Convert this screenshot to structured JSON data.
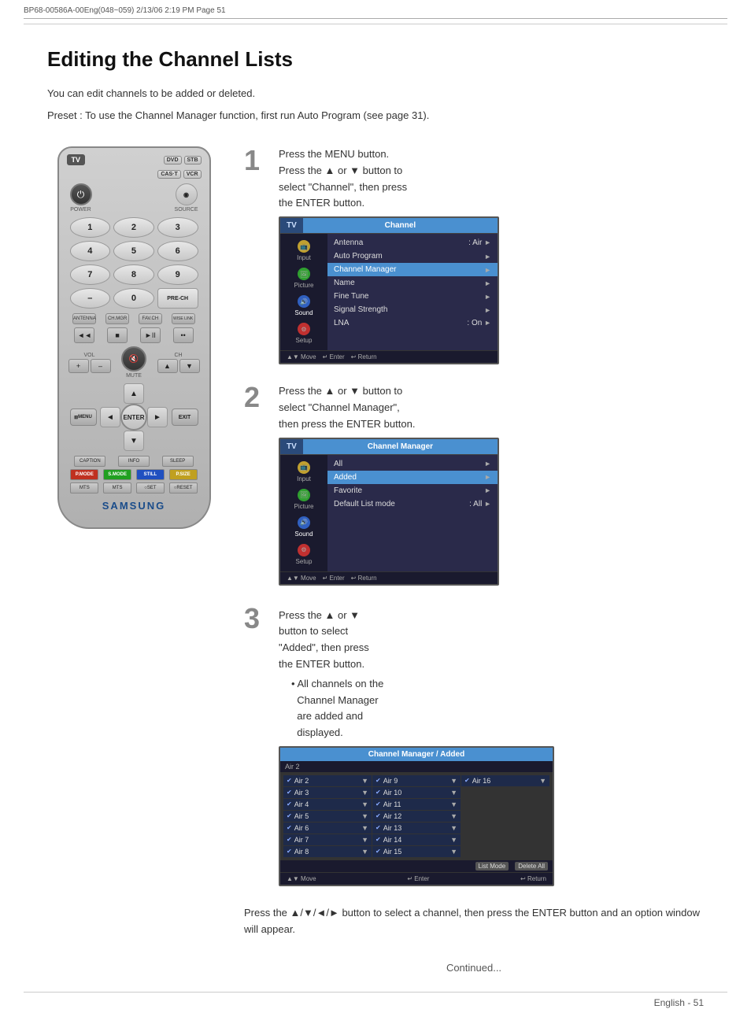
{
  "header": {
    "left_text": "BP68-00586A-00Eng(048~059)  2/13/06  2:19 PM  Page 51"
  },
  "page_title": "Editing the Channel Lists",
  "intro_lines": [
    "You can edit channels to be added or deleted.",
    "Preset : To use the Channel Manager function, first run Auto Program (see page 31)."
  ],
  "steps": [
    {
      "num": "1",
      "text_lines": [
        "Press the MENU button.",
        "Press the ▲ or ▼ button to",
        "select \"Channel\", then press",
        "the ENTER button."
      ]
    },
    {
      "num": "2",
      "text_lines": [
        "Press the ▲ or ▼ button to",
        "select \"Channel Manager\",",
        "then press the ENTER button."
      ]
    },
    {
      "num": "3",
      "text_lines": [
        "Press the ▲ or ▼",
        "button to select",
        "\"Added\", then press",
        "the ENTER button."
      ],
      "bullet": "All channels on the Channel Manager are added and displayed."
    }
  ],
  "press_arrow_text": "Press the ▲/▼/◄/► button to select a channel, then press the ENTER button and an option window will appear.",
  "continued_text": "Continued...",
  "footer": {
    "page_text": "English - 51"
  },
  "tv_menu_1": {
    "header_left": "TV",
    "header_right": "Channel",
    "sidebar_items": [
      {
        "icon": "input",
        "label": "Input"
      },
      {
        "icon": "picture",
        "label": "Picture"
      },
      {
        "icon": "sound",
        "label": "Sound"
      },
      {
        "icon": "setup",
        "label": "Setup"
      }
    ],
    "menu_items": [
      {
        "label": "Antenna",
        "value": ": Air",
        "selected": false
      },
      {
        "label": "Auto Program",
        "value": "",
        "selected": false
      },
      {
        "label": "Channel Manager",
        "value": "",
        "selected": true
      },
      {
        "label": "Name",
        "value": "",
        "selected": false
      },
      {
        "label": "Fine Tune",
        "value": "",
        "selected": false
      },
      {
        "label": "Signal Strength",
        "value": "",
        "selected": false
      },
      {
        "label": "LNA",
        "value": ": On",
        "selected": false
      }
    ],
    "footer": [
      "▲▼ Move",
      "↵ Enter",
      "↩ Return"
    ]
  },
  "tv_menu_2": {
    "header_left": "TV",
    "header_right": "Channel Manager",
    "menu_items": [
      {
        "label": "All",
        "value": "",
        "selected": false
      },
      {
        "label": "Added",
        "value": "",
        "selected": true
      },
      {
        "label": "Favorite",
        "value": "",
        "selected": false
      },
      {
        "label": "Default List mode",
        "value": ": All",
        "selected": false
      }
    ],
    "footer": [
      "▲▼ Move",
      "↵ Enter",
      "↩ Return"
    ]
  },
  "ch_manager": {
    "title": "Channel Manager / Added",
    "top_label": "Air 2",
    "channels_col1": [
      "Air 2",
      "Air 3",
      "Air 4",
      "Air 5",
      "Air 6",
      "Air 7",
      "Air 8"
    ],
    "channels_col2": [
      "Air 9",
      "Air 10",
      "Air 11",
      "Air 12",
      "Air 13",
      "Air 14",
      "Air 15"
    ],
    "channels_col3": [
      "Air 16"
    ],
    "footer_left": "▲▼ Move",
    "footer_mid": "↵ Enter",
    "footer_btn1": "List Mode",
    "footer_btn2": "Delete All",
    "footer_right": "↩ Return"
  },
  "remote": {
    "tv_label": "TV",
    "source_btns": [
      "DVD",
      "STB",
      "CAS·T",
      "VCR"
    ],
    "power_label": "POWER",
    "source_label": "SOURCE",
    "numpad": [
      "1",
      "2",
      "3",
      "4",
      "5",
      "6",
      "7",
      "8",
      "9",
      "–",
      "0",
      "PRE-CH"
    ],
    "func_btns": [
      "ANTENNA",
      "CH.MGR",
      "FAV.CH",
      "WISE LINK"
    ],
    "transport_btns": [
      "◄◄",
      "■",
      "►II",
      "••",
      "••",
      "••"
    ],
    "vol_label": "VOL",
    "ch_label": "CH",
    "mute_label": "MUTE",
    "menu_label": "MENU",
    "exit_label": "EXIT",
    "enter_label": "ENTER",
    "caption_btns": [
      "CAPTION",
      "INFO",
      "SLEEP"
    ],
    "color_btns": [
      {
        "label": "P.MODE",
        "color": "#c03020"
      },
      {
        "label": "S.MODE",
        "color": "#20a020"
      },
      {
        "label": "STILL",
        "color": "#2050c0"
      },
      {
        "label": "P.SIZE",
        "color": "#c0a020"
      }
    ],
    "bottom_btns": [
      "MTS",
      "MTS",
      "○ SET",
      "○ RESET"
    ],
    "samsung_label": "SAMSUNG"
  }
}
